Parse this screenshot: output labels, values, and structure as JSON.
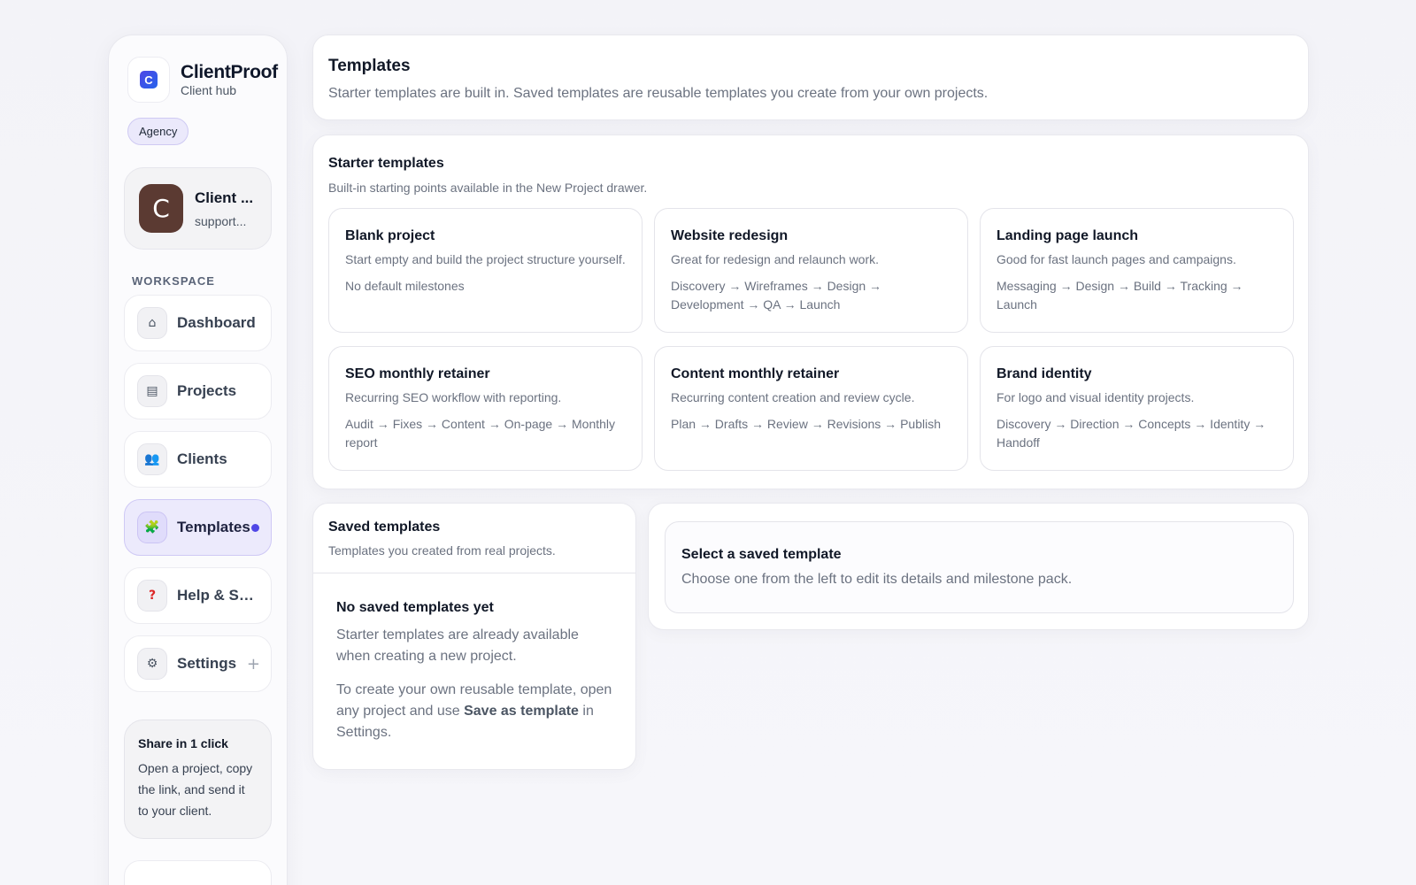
{
  "brand": {
    "name": "ClientProof",
    "subtitle": "Client hub",
    "logo_letter": "C",
    "badge": "Agency"
  },
  "user": {
    "initial": "C",
    "name": "Client ...",
    "email": "support..."
  },
  "sidebar": {
    "section_label": "WORKSPACE",
    "items": [
      {
        "label": "Dashboard",
        "icon": "home-icon",
        "glyph": "⌂"
      },
      {
        "label": "Projects",
        "icon": "folder-icon",
        "glyph": "▤"
      },
      {
        "label": "Clients",
        "icon": "users-icon",
        "glyph": "👥"
      },
      {
        "label": "Templates",
        "icon": "puzzle-icon",
        "glyph": "🧩",
        "active": true
      },
      {
        "label": "Help & Su...",
        "icon": "help-icon",
        "glyph": "?"
      },
      {
        "label": "Settings",
        "icon": "gear-icon",
        "glyph": "⚙",
        "trailing": "+"
      }
    ],
    "share": {
      "title": "Share in 1 click",
      "body": "Open a project, copy the link, and send it to your client."
    }
  },
  "header": {
    "title": "Templates",
    "description": "Starter templates are built in. Saved templates are reusable templates you create from your own projects."
  },
  "starter": {
    "title": "Starter templates",
    "subtitle": "Built-in starting points available in the New Project drawer.",
    "templates": [
      {
        "name": "Blank project",
        "description": "Start empty and build the project structure yourself.",
        "steps": "No default milestones"
      },
      {
        "name": "Website redesign",
        "description": "Great for redesign and relaunch work.",
        "steps": "Discovery → Wireframes → Design → Development → QA → Launch"
      },
      {
        "name": "Landing page launch",
        "description": "Good for fast launch pages and campaigns.",
        "steps": "Messaging → Design → Build → Tracking → Launch"
      },
      {
        "name": "SEO monthly retainer",
        "description": "Recurring SEO workflow with reporting.",
        "steps": "Audit → Fixes → Content → On-page → Monthly report"
      },
      {
        "name": "Content monthly retainer",
        "description": "Recurring content creation and review cycle.",
        "steps": "Plan → Drafts → Review → Revisions → Publish"
      },
      {
        "name": "Brand identity",
        "description": "For logo and visual identity projects.",
        "steps": "Discovery → Direction → Concepts → Identity → Handoff"
      }
    ]
  },
  "saved": {
    "title": "Saved templates",
    "subtitle": "Templates you created from real projects.",
    "empty_title": "No saved templates yet",
    "empty_text_1": "Starter templates are already available when creating a new project.",
    "empty_text_2_before": "To create your own reusable template, open any project and use ",
    "empty_text_2_bold": "Save as template",
    "empty_text_2_after": " in Settings."
  },
  "detail": {
    "title": "Select a saved template",
    "description": "Choose one from the left to edit its details and milestone pack."
  },
  "colors": {
    "accent": "#5047e6",
    "active_bg": "#eceafc",
    "avatar": "#5b3a32"
  }
}
